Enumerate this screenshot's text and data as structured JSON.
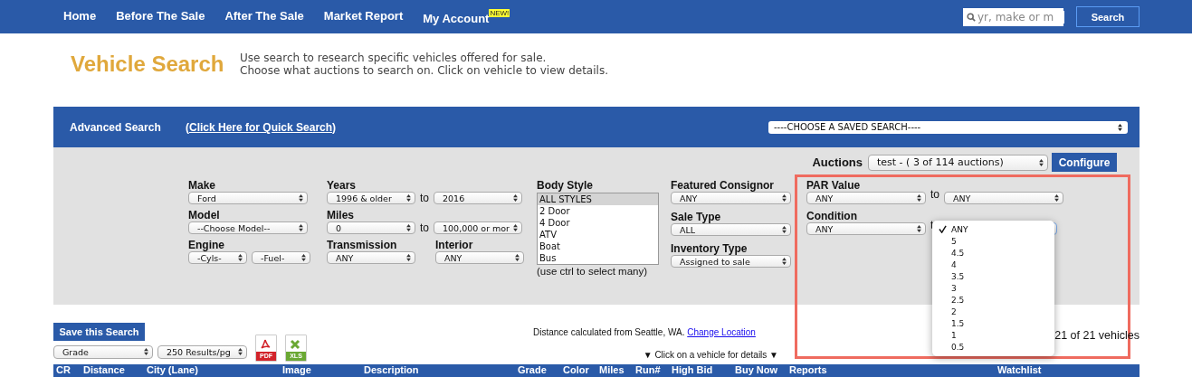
{
  "nav": {
    "items": [
      {
        "label": "Home"
      },
      {
        "label": "Before The Sale"
      },
      {
        "label": "After The Sale"
      },
      {
        "label": "Market Report"
      },
      {
        "label": "My Account",
        "badge": "NEW!"
      }
    ],
    "search": {
      "placeholder": "yr, make or m"
    },
    "search_button": "Search"
  },
  "header": {
    "title": "Vehicle Search",
    "lines": [
      "Use search to research specific vehicles offered for sale.",
      "Choose what auctions to search on. Click on vehicle to view details."
    ]
  },
  "advanced": {
    "title": "Advanced Search",
    "quick_link": "(Click Here for Quick Search)",
    "saved_search": "----CHOOSE A SAVED SEARCH----",
    "auctions": {
      "label": "Auctions",
      "value": "test - ( 3 of 114 auctions)",
      "button": "Configure"
    },
    "make": {
      "label": "Make",
      "value": "Ford"
    },
    "model": {
      "label": "Model",
      "value": "--Choose Model--"
    },
    "engine": {
      "label": "Engine",
      "cyls": "-Cyls-",
      "fuel": "-Fuel-"
    },
    "years": {
      "label": "Years",
      "from": "1996 & older",
      "to_label": "to",
      "to": "2016"
    },
    "miles": {
      "label": "Miles",
      "from": "0",
      "to_label": "to",
      "to": "100,000 or mor"
    },
    "transmission": {
      "label": "Transmission",
      "value": "ANY"
    },
    "interior": {
      "label": "Interior",
      "value": "ANY"
    },
    "body_style": {
      "label": "Body Style",
      "options": [
        {
          "label": "ALL STYLES",
          "selected": true
        },
        {
          "label": "2 Door",
          "selected": false
        },
        {
          "label": "4 Door",
          "selected": false
        },
        {
          "label": "ATV",
          "selected": false
        },
        {
          "label": "Boat",
          "selected": false
        },
        {
          "label": "Bus",
          "selected": false
        }
      ],
      "hint": "(use ctrl to select many)"
    },
    "featured_consignor": {
      "label": "Featured Consignor",
      "value": "ANY"
    },
    "sale_type": {
      "label": "Sale Type",
      "value": "ALL"
    },
    "inventory_type": {
      "label": "Inventory Type",
      "value": "Assigned to sale"
    },
    "par_value": {
      "label": "PAR Value",
      "from": "ANY",
      "to_label": "to",
      "to": "ANY"
    },
    "condition": {
      "label": "Condition",
      "from": "ANY",
      "to_label": "t",
      "menu": [
        {
          "label": "ANY",
          "selected": true
        },
        {
          "label": "5",
          "selected": false
        },
        {
          "label": "4.5",
          "selected": false
        },
        {
          "label": "4",
          "selected": false
        },
        {
          "label": "3.5",
          "selected": false
        },
        {
          "label": "3",
          "selected": false
        },
        {
          "label": "2.5",
          "selected": false
        },
        {
          "label": "2",
          "selected": false
        },
        {
          "label": "1.5",
          "selected": false
        },
        {
          "label": "1",
          "selected": false
        },
        {
          "label": "0.5",
          "selected": false
        }
      ]
    }
  },
  "results": {
    "save_button": "Save this Search",
    "sort": "Grade",
    "per_page": "250 Results/pg",
    "exports": [
      {
        "kind": "pdf",
        "label": "PDF"
      },
      {
        "kind": "xls",
        "label": "XLS"
      }
    ],
    "distance_note": "Distance calculated from Seattle, WA.",
    "change_location": "Change Location",
    "count": "21 of 21 vehicles",
    "click_hint": "▼ Click on a vehicle for details ▼"
  },
  "table": {
    "columns": [
      "CR",
      "Distance",
      "City (Lane)",
      "Image",
      "Description",
      "Grade",
      "Color",
      "Miles",
      "Run#",
      "High Bid",
      "Buy Now",
      "Reports",
      "Watchlist"
    ]
  }
}
